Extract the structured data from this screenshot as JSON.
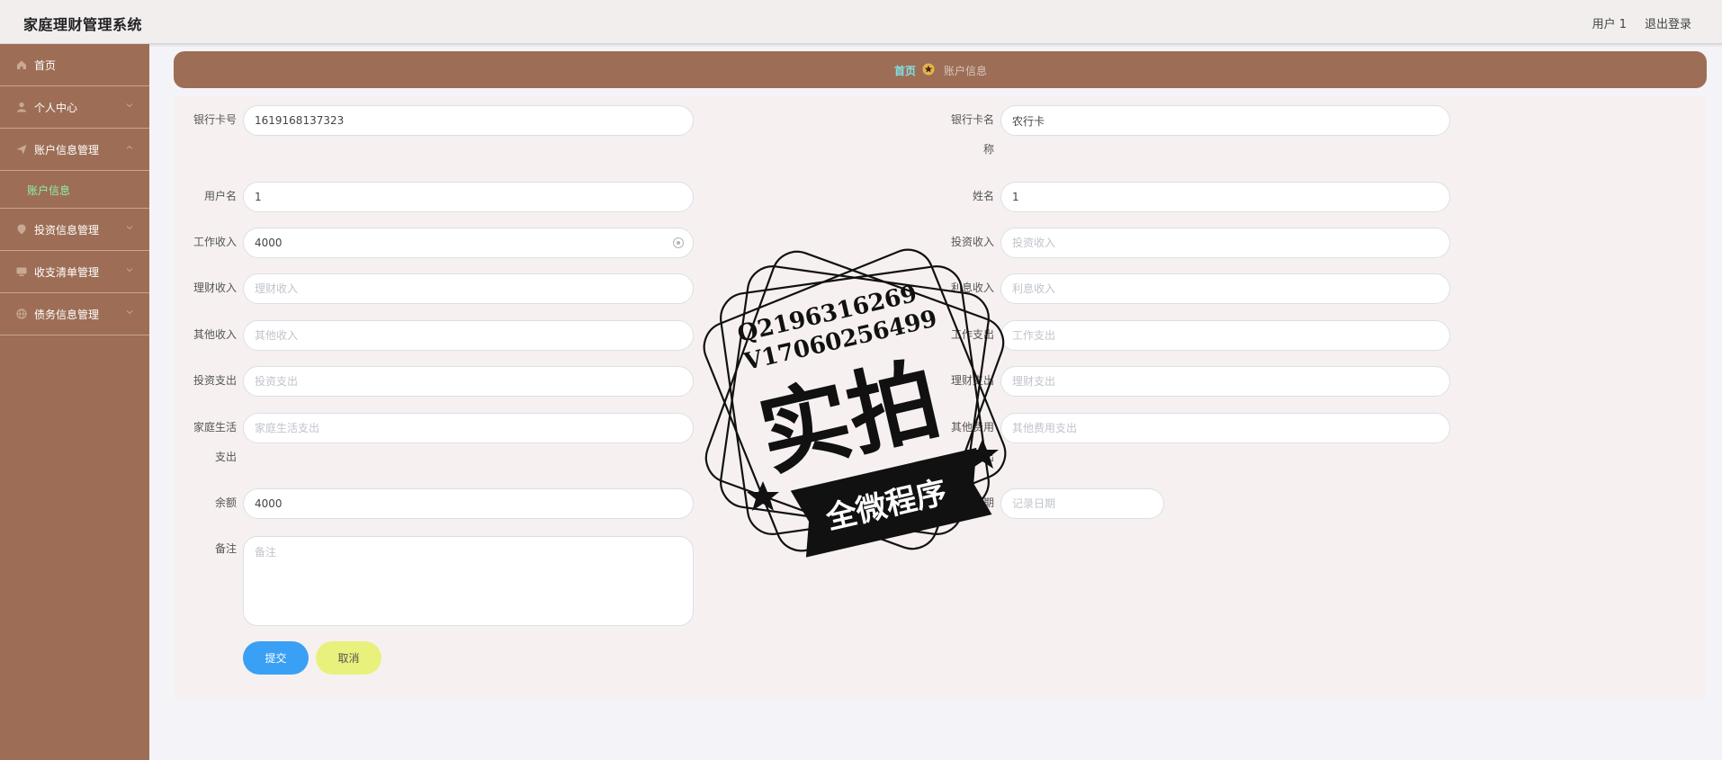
{
  "app": {
    "title": "家庭理财管理系统"
  },
  "topbar": {
    "user": "用户 1",
    "logout": "退出登录"
  },
  "sidebar": {
    "items": [
      {
        "label": "首页",
        "icon": "home-icon"
      },
      {
        "label": "个人中心",
        "icon": "user-icon"
      },
      {
        "label": "账户信息管理",
        "icon": "send-icon"
      },
      {
        "label": "账户信息",
        "sub": true
      },
      {
        "label": "投资信息管理",
        "icon": "location-icon"
      },
      {
        "label": "收支清单管理",
        "icon": "monitor-icon"
      },
      {
        "label": "债务信息管理",
        "icon": "globe-icon"
      }
    ]
  },
  "breadcrumb": {
    "home": "首页",
    "current": "账户信息"
  },
  "form": {
    "bank_card_no": {
      "label": "银行卡号",
      "value": "1619168137323"
    },
    "bank_card_name": {
      "label_line1": "银行卡名",
      "label_line2": "称",
      "value": "农行卡"
    },
    "username": {
      "label": "用户名",
      "value": "1"
    },
    "name": {
      "label": "姓名",
      "value": "1"
    },
    "work_income": {
      "label": "工作收入",
      "value": "4000"
    },
    "invest_income": {
      "label": "投资收入",
      "placeholder": "投资收入"
    },
    "finance_income": {
      "label": "理财收入",
      "placeholder": "理财收入"
    },
    "interest_income": {
      "label": "利息收入",
      "placeholder": "利息收入"
    },
    "other_income": {
      "label": "其他收入",
      "placeholder": "其他收入"
    },
    "work_expense": {
      "label": "工作支出",
      "placeholder": "工作支出"
    },
    "invest_expense": {
      "label": "投资支出",
      "placeholder": "投资支出"
    },
    "finance_expense": {
      "label": "理财支出",
      "placeholder": "理财支出"
    },
    "family_expense": {
      "label_line1": "家庭生活",
      "label_line2": "支出",
      "placeholder": "家庭生活支出"
    },
    "other_expense": {
      "label_line1": "其他费用",
      "label_line2": "支出",
      "placeholder": "其他费用支出"
    },
    "balance": {
      "label": "余额",
      "value": "4000"
    },
    "record_date": {
      "label": "记录日期",
      "placeholder": "记录日期"
    },
    "remark": {
      "label": "备注",
      "placeholder": "备注"
    },
    "submit": "提交",
    "cancel": "取消"
  },
  "watermark": {
    "line1": "Q2196316269",
    "line2": "V17060256499",
    "main": "实拍",
    "banner": "全微程序"
  }
}
